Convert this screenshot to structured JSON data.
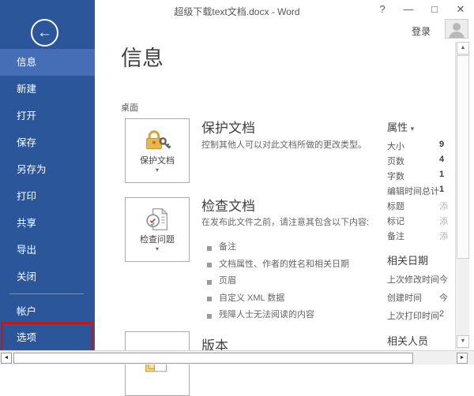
{
  "titlebar": {
    "title": "超级下载text文档.docx - Word",
    "controls": {
      "help": "?",
      "minimize": "—",
      "maximize": "□",
      "close": "✕"
    },
    "sign_in": "登录"
  },
  "sidebar": {
    "items": [
      {
        "label": "信息"
      },
      {
        "label": "新建"
      },
      {
        "label": "打开"
      },
      {
        "label": "保存"
      },
      {
        "label": "另存为"
      },
      {
        "label": "打印"
      },
      {
        "label": "共享"
      },
      {
        "label": "导出"
      },
      {
        "label": "关闭"
      },
      {
        "label": "帐户"
      },
      {
        "label": "选项"
      }
    ],
    "back_arrow": "←"
  },
  "info": {
    "page_title": "信息",
    "location": "桌面",
    "protect": {
      "button_label": "保护文档",
      "heading": "保护文档",
      "description": "控制其他人可以对此文档所做的更改类型。"
    },
    "inspect": {
      "button_label": "检查问题",
      "heading": "检查文档",
      "description": "在发布此文件之前，请注意其包含以下内容:",
      "bullets": [
        "备注",
        "文档属性、作者的姓名和相关日期",
        "页眉",
        "自定义 XML 数据",
        "残障人士无法阅读的内容"
      ]
    },
    "versions": {
      "heading": "版本"
    }
  },
  "properties": {
    "heading": "属性",
    "rows": [
      {
        "label": "大小",
        "value": "9"
      },
      {
        "label": "页数",
        "value": "4"
      },
      {
        "label": "字数",
        "value": "1"
      },
      {
        "label": "编辑时间总计",
        "value": "1"
      },
      {
        "label": "标题",
        "value": "添"
      },
      {
        "label": "标记",
        "value": "添"
      },
      {
        "label": "备注",
        "value": "添"
      }
    ],
    "dates_heading": "相关日期",
    "date_rows": [
      {
        "label": "上次修改时间",
        "value": "今"
      },
      {
        "label": "创建时间",
        "value": "今"
      },
      {
        "label": "上次打印时间",
        "value": "2"
      }
    ],
    "people_heading": "相关人员"
  },
  "colors": {
    "sidebar_blue": "#2b579a",
    "sidebar_selected_blue": "#466eb6",
    "highlight_red": "#c11818",
    "lock_gold": "#e2b13c"
  }
}
